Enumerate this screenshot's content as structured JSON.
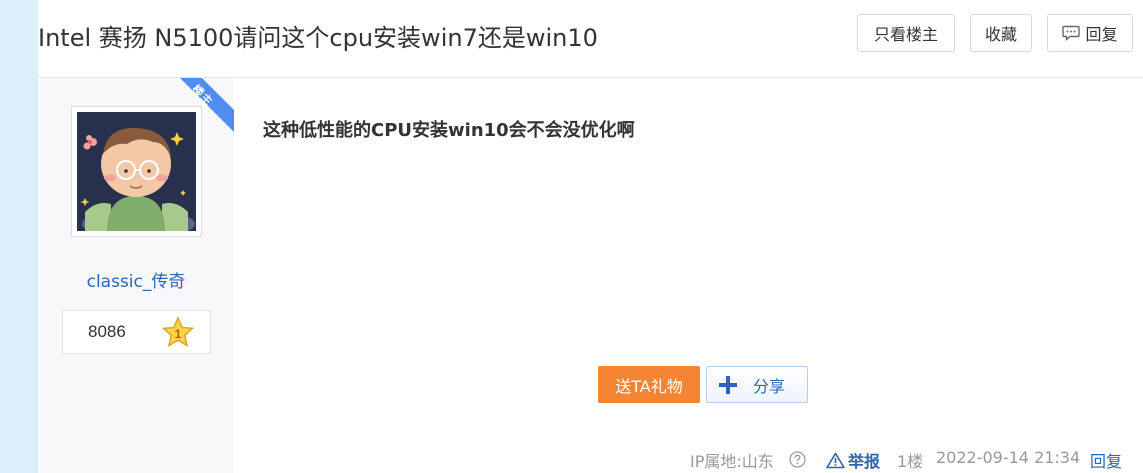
{
  "thread": {
    "title": "Intel 赛扬 N5100请问这个cpu安装win7还是win10",
    "only_louzhu_label": "只看楼主",
    "favorite_label": "收藏",
    "reply_label": "回复"
  },
  "author": {
    "badge": "楼主",
    "username": "classic_传奇",
    "level_name": "8086",
    "level_number": "1"
  },
  "post": {
    "content": "这种低性能的CPU安装win10会不会没优化啊",
    "gift_label": "送TA礼物",
    "share_label": "分享",
    "ip_location": "IP属地:山东",
    "report_label": "举报",
    "floor": "1楼",
    "time": "2022-09-14 21:34",
    "reply_label": "回复"
  },
  "colors": {
    "link_blue": "#2d64b3",
    "gift_orange": "#f58533",
    "ribbon_blue": "#4f8ef0",
    "strip_blue": "#ddeefb"
  }
}
